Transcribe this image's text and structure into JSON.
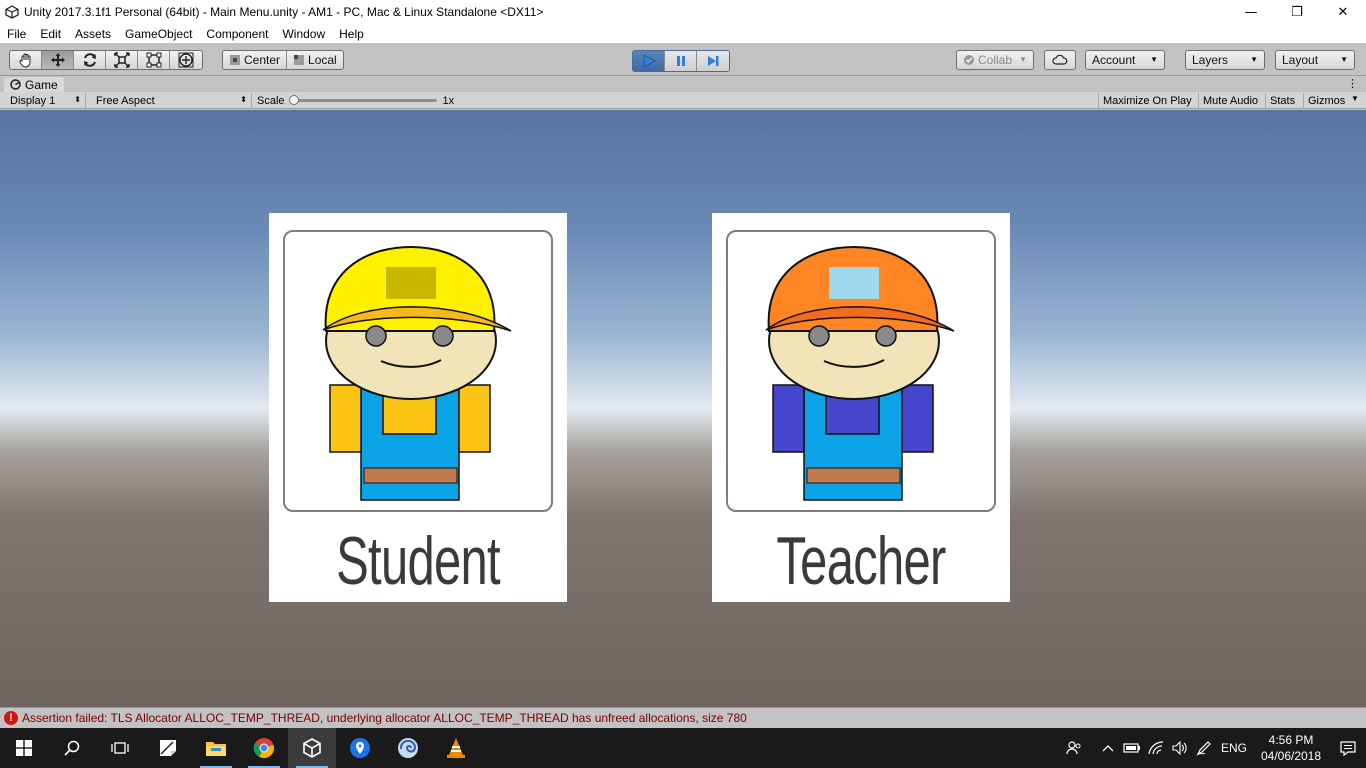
{
  "window": {
    "title": "Unity 2017.3.1f1 Personal (64bit) - Main Menu.unity - AM1 - PC, Mac & Linux Standalone <DX11>",
    "minimize_glyph": "—",
    "maximize_glyph": "❐",
    "close_glyph": "✕"
  },
  "menu": {
    "items": [
      "File",
      "Edit",
      "Assets",
      "GameObject",
      "Component",
      "Window",
      "Help"
    ]
  },
  "toolbar": {
    "tools": [
      "hand-icon",
      "move-icon",
      "rotate-icon",
      "scale-icon",
      "rect-icon",
      "transform-icon"
    ],
    "active_tool": "move-icon",
    "pivot_mode": "Center",
    "pivot_rotation": "Local",
    "play_active": true,
    "collab_label": "Collab",
    "account_label": "Account",
    "layers_label": "Layers",
    "layout_label": "Layout"
  },
  "game_tab": {
    "label": "Game",
    "display": "Display 1",
    "aspect": "Free Aspect",
    "scale_label": "Scale",
    "scale_value": "1x",
    "maximize_on_play": "Maximize On Play",
    "mute_audio": "Mute Audio",
    "stats": "Stats",
    "gizmos": "Gizmos"
  },
  "scene": {
    "cards": [
      {
        "label": "Student",
        "hat_color": "#fff000",
        "hat_patch_color": "#c9b800",
        "brim_color": "#f7b81e",
        "sleeve_color": "#fcc414",
        "shirt_color": "#fcc414",
        "overall_color": "#0ca3e6",
        "belt_color": "#c07a4e"
      },
      {
        "label": "Teacher",
        "hat_color": "#fe8523",
        "hat_patch_color": "#9fd8ea",
        "brim_color": "#f26c20",
        "sleeve_color": "#4646cc",
        "shirt_color": "#4646cc",
        "overall_color": "#0ca3e6",
        "belt_color": "#c07a4e"
      }
    ]
  },
  "status": {
    "message": "Assertion failed: TLS Allocator ALLOC_TEMP_THREAD, underlying allocator ALLOC_TEMP_THREAD has unfreed allocations, size 780"
  },
  "taskbar": {
    "apps": [
      "windows-start-icon",
      "search-icon",
      "task-view-icon",
      "sticky-notes-icon",
      "file-explorer-icon",
      "chrome-icon",
      "unity-icon",
      "maps-icon",
      "app-icon",
      "vlc-icon"
    ],
    "language": "ENG",
    "time": "4:56 PM",
    "date": "04/06/2018"
  }
}
